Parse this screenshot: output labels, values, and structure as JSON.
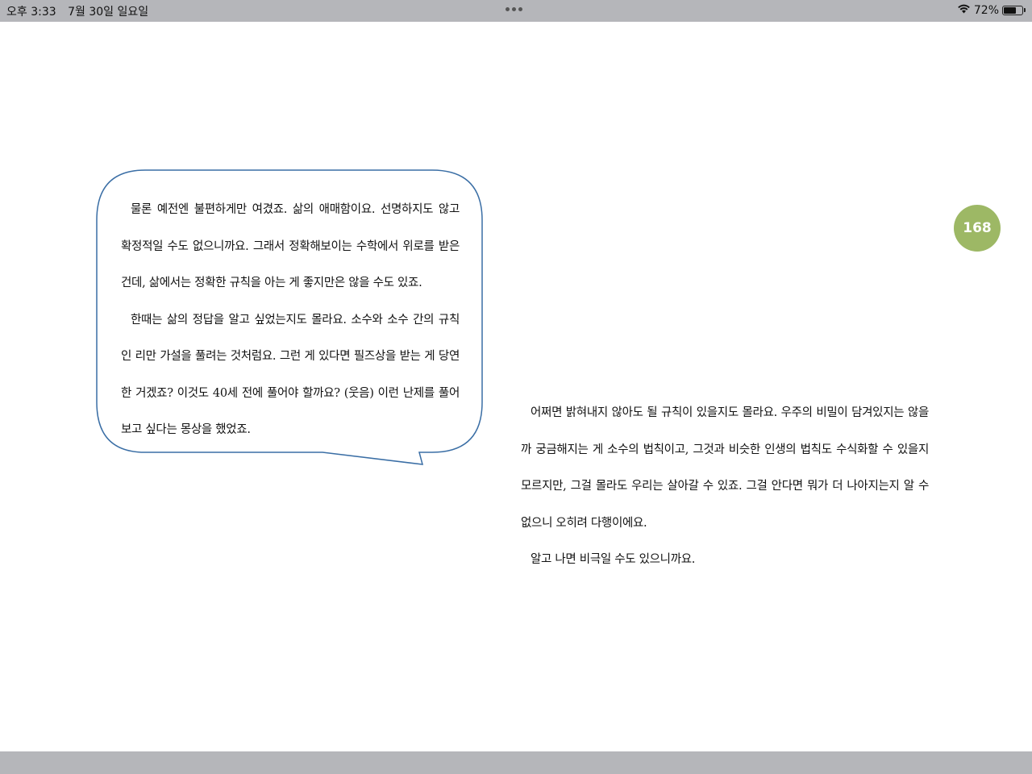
{
  "status_bar": {
    "time": "오후 3:33",
    "date": "7월 30일 일요일",
    "battery_percent": "72%",
    "battery_level": 0.72,
    "wifi_icon": "wifi-icon",
    "battery_icon": "battery-icon",
    "multitask_icon": "more-dots-icon"
  },
  "book": {
    "page_number": "168",
    "page_badge_color": "#9db865",
    "bubble_border_color": "#3a6ea5",
    "bubble_paragraphs": [
      "물론 예전엔 불편하게만 여겼죠. 삶의 애매함이요. 선명하지도 않고 확정적일 수도 없으니까요. 그래서 정확해보이는 수학에서 위로를 받은 건데, 삶에서는 정확한 규칙을 아는 게 좋지만은 않을 수도 있죠.",
      "한때는 삶의 정답을 알고 싶었는지도 몰라요. 소수와 소수 간의 규칙인 리만 가설을 풀려는 것처럼요. 그런 게 있다면 필즈상을 받는 게 당연한 거겠죠? 이것도 40세 전에 풀어야 할까요? (웃음) 이런 난제를 풀어보고 싶다는 몽상을 했었죠."
    ],
    "body_paragraphs": [
      "어쩌면 밝혀내지 않아도 될 규칙이 있을지도 몰라요. 우주의 비밀이 담겨있지는 않을까 궁금해지는 게 소수의 법칙이고, 그것과 비슷한 인생의 법칙도 수식화할 수 있을지 모르지만, 그걸 몰라도 우리는 살아갈 수 있죠. 그걸 안다면 뭐가 더 나아지는지 알 수 없으니 오히려 다행이에요.",
      "알고 나면 비극일 수도 있으니까요."
    ]
  }
}
